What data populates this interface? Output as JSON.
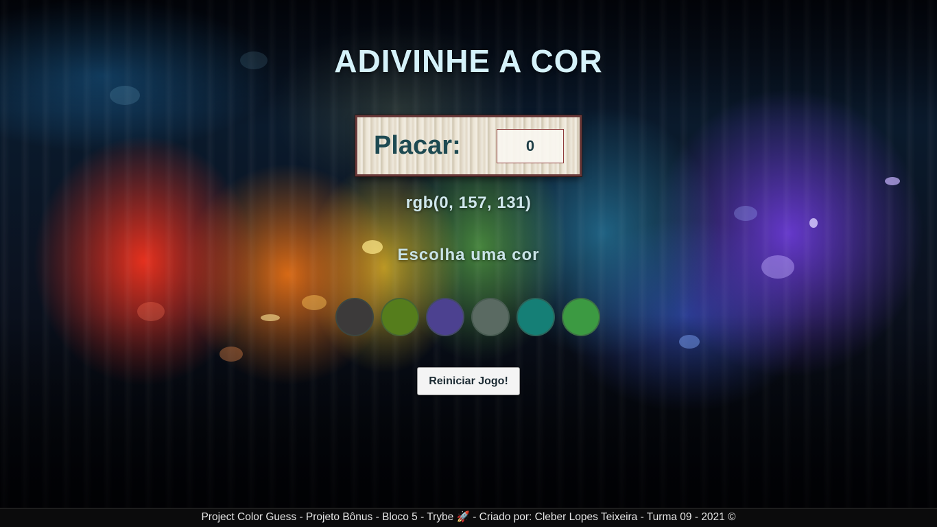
{
  "page": {
    "title": "ADIVINHE A COR"
  },
  "score": {
    "label": "Placar:",
    "value": "0"
  },
  "target": {
    "rgb_text": "rgb(0, 157, 131)"
  },
  "status": {
    "answer_text": "Escolha uma cor"
  },
  "balls": [
    {
      "name": "color-ball-1",
      "color": "#3c3a3a"
    },
    {
      "name": "color-ball-2",
      "color": "#557d1c"
    },
    {
      "name": "color-ball-3",
      "color": "#4c4190"
    },
    {
      "name": "color-ball-4",
      "color": "#5a6a62"
    },
    {
      "name": "color-ball-5",
      "color": "#157f76"
    },
    {
      "name": "color-ball-6",
      "color": "#3c9a42"
    }
  ],
  "controls": {
    "reset_label": "Reiniciar Jogo!"
  },
  "footer": {
    "text": "Project Color Guess - Projeto Bônus - Bloco 5 - Trybe 🚀 - Criado por: Cleber Lopes Teixeira - Turma 09 - 2021 ©"
  }
}
